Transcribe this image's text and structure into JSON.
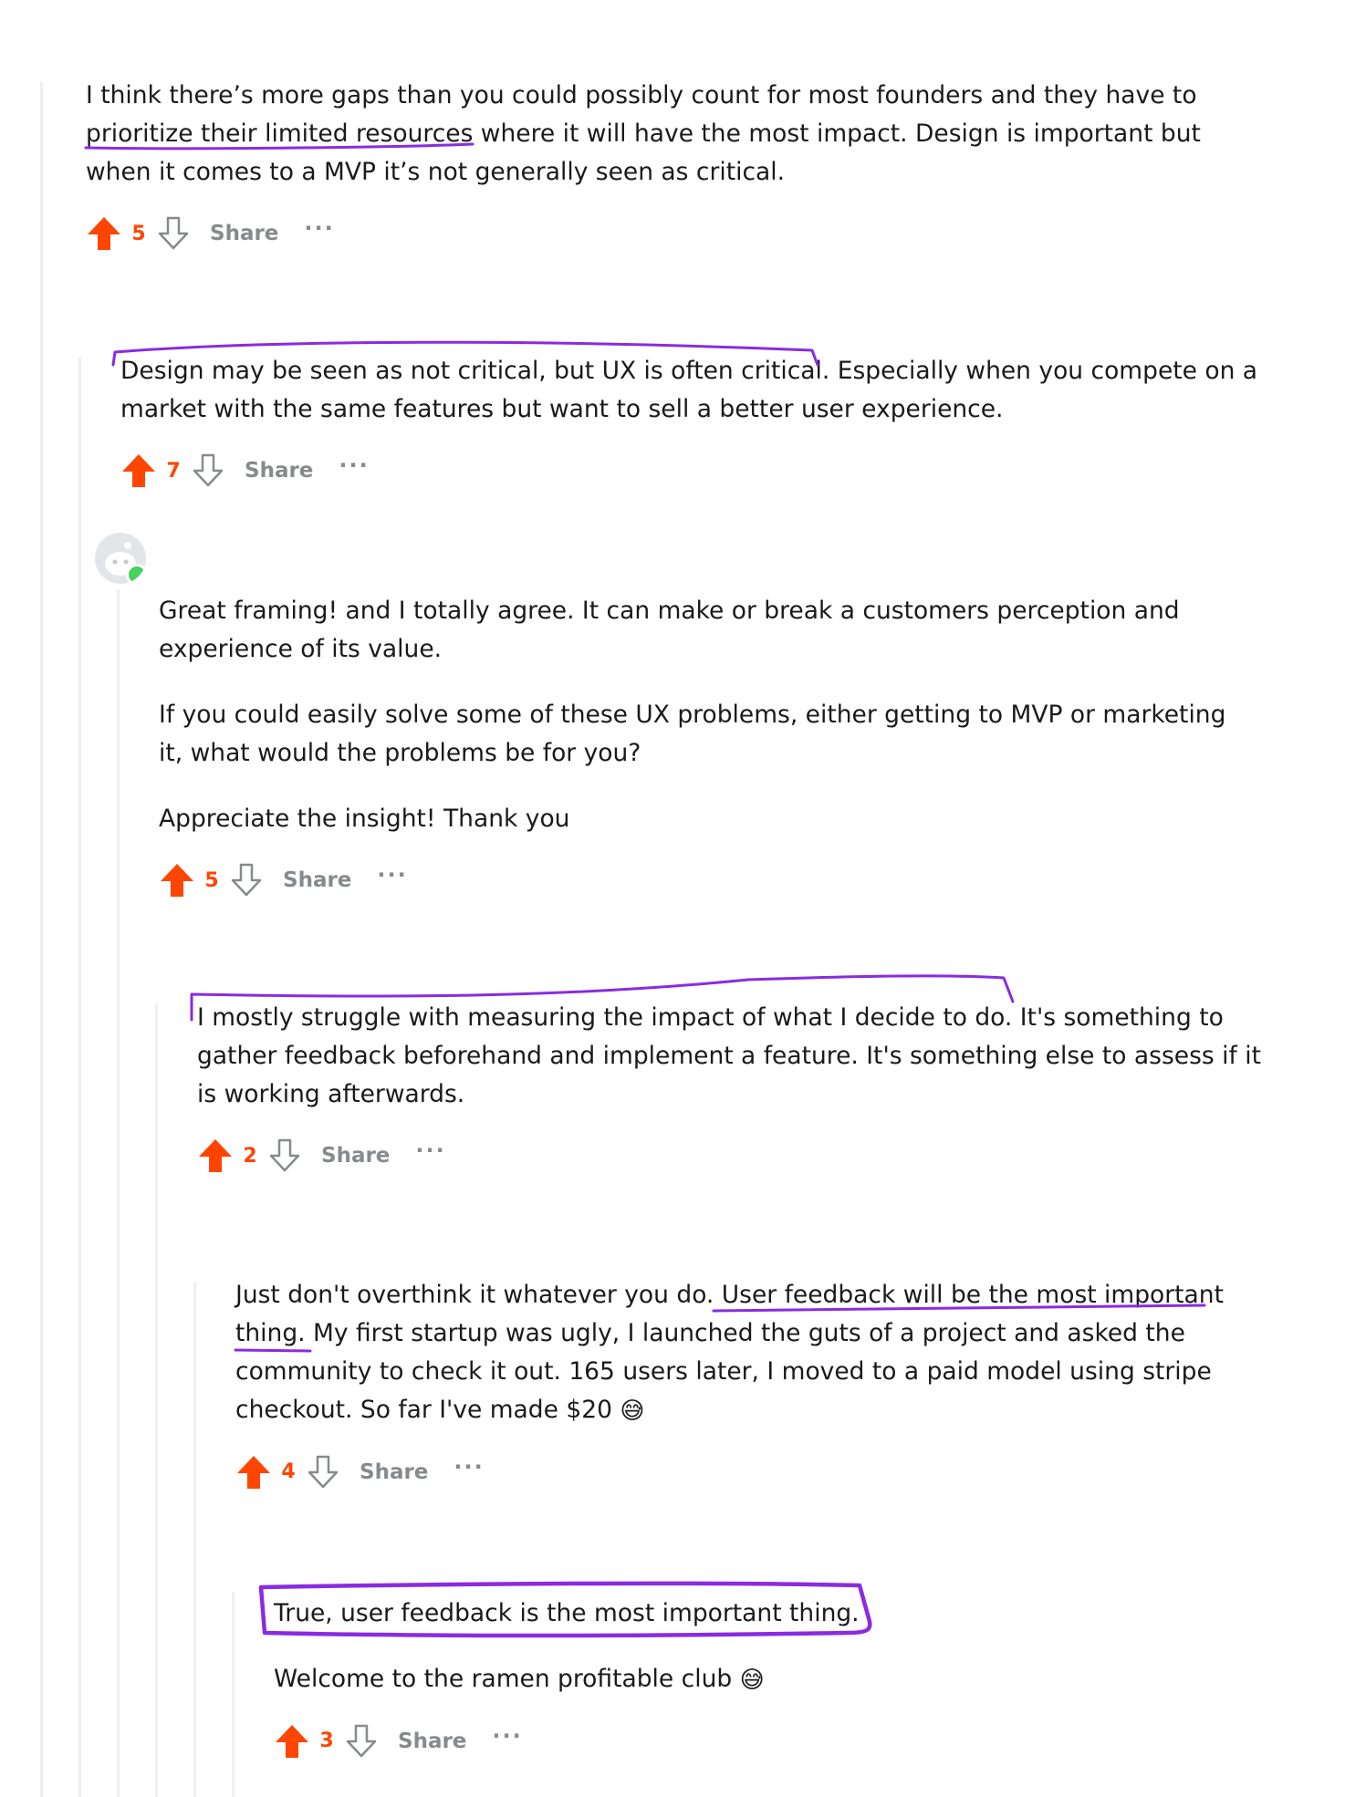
{
  "comments": [
    {
      "paragraphs": [
        "I think there’s more gaps than you could possibly count for most founders and they have to prioritize their limited resources where it will have the most impact. Design is important but when it comes to a MVP it’s not generally seen as critical."
      ],
      "votes": "5"
    },
    {
      "paragraphs": [
        "Design may be seen as not critical, but UX is often critical. Especially when you compete on a market with the same features but want to sell a better user experience."
      ],
      "votes": "7"
    },
    {
      "paragraphs": [
        "Great framing! and I totally agree. It can make or break a customers perception and experience of its value.",
        "If you could easily solve some of these UX problems, either getting to MVP or marketing it, what would the problems be for you?",
        "Appreciate the insight! Thank you"
      ],
      "votes": "5"
    },
    {
      "paragraphs": [
        "I mostly struggle with measuring the impact of what I decide to do. It's something to gather feedback beforehand and implement a feature. It's something else to assess if it is working afterwards."
      ],
      "votes": "2"
    },
    {
      "paragraphs": [
        "Just don't overthink it whatever you do. User feedback will be the most important thing. My first startup was ugly, I launched the guts of a project and asked the community to check it out. 165 users later, I moved to a paid model using stripe checkout. So far I've made $20"
      ],
      "emoji": "😅",
      "votes": "4"
    },
    {
      "paragraphs": [
        "True, user feedback is the most important thing.",
        "Welcome to the ramen profitable club"
      ],
      "emoji": "😅",
      "votes": "3"
    }
  ],
  "labels": {
    "share": "Share",
    "more": "···"
  },
  "colors": {
    "upvote": "#ff4500",
    "annotation": "#8a2be2",
    "muted": "#878a8c"
  }
}
